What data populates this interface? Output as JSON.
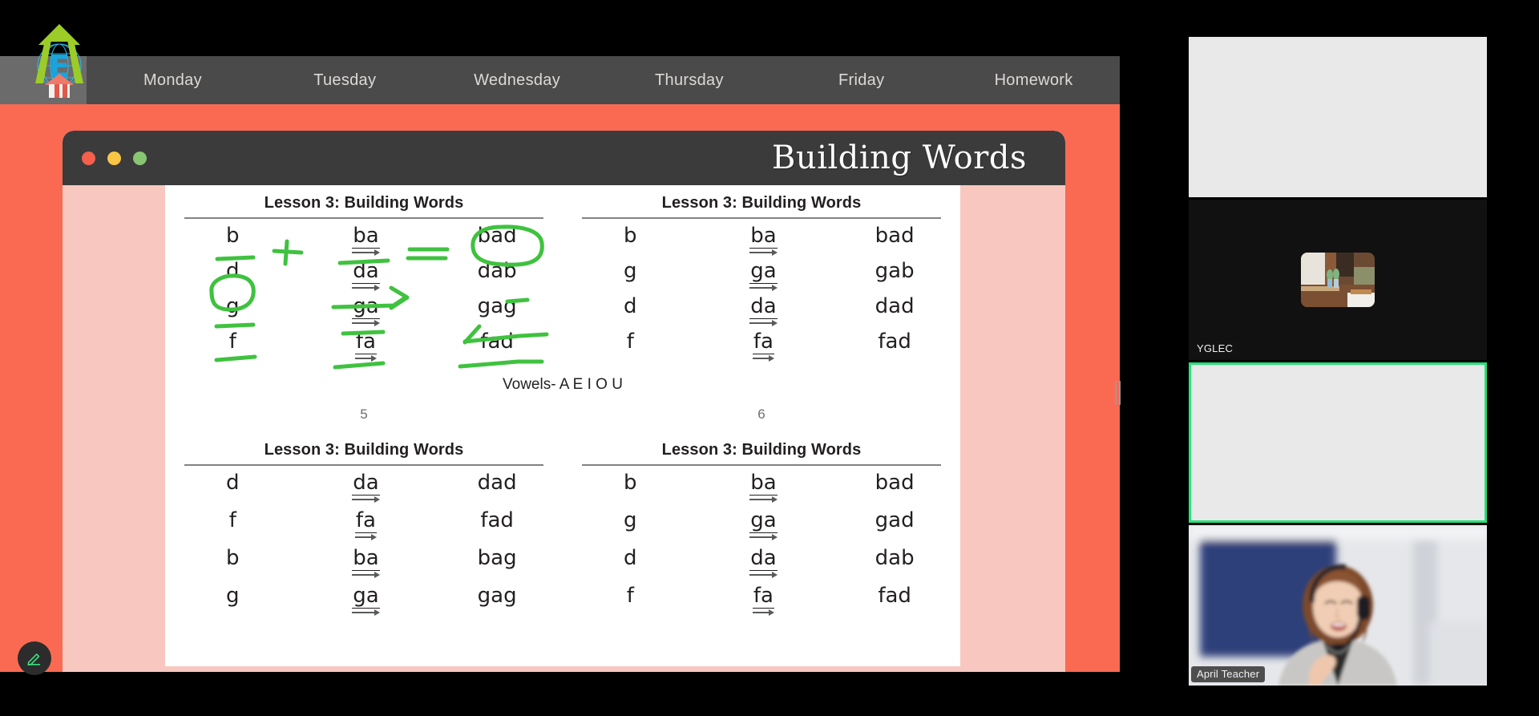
{
  "app": {
    "logo_alt": "school-logo"
  },
  "nav": {
    "tabs": [
      {
        "label": "Monday"
      },
      {
        "label": "Tuesday"
      },
      {
        "label": "Wednesday"
      },
      {
        "label": "Thursday"
      },
      {
        "label": "Friday"
      },
      {
        "label": "Homework"
      }
    ]
  },
  "slide": {
    "title": "Building Words",
    "window_controls": [
      "close",
      "minimize",
      "maximize"
    ]
  },
  "worksheet": {
    "heading": "Lesson 3: Building Words",
    "vowels_note": "Vowels- A E I O U",
    "page_numbers": [
      "5",
      "6"
    ],
    "tables": [
      {
        "id": "top-left",
        "page": "5",
        "rows": [
          {
            "letter": "b",
            "blend": "ba",
            "word": "bad"
          },
          {
            "letter": "d",
            "blend": "da",
            "word": "dab"
          },
          {
            "letter": "g",
            "blend": "ga",
            "word": "gag"
          },
          {
            "letter": "f",
            "blend": "fa",
            "word": "fad"
          }
        ]
      },
      {
        "id": "top-right",
        "page": "6",
        "rows": [
          {
            "letter": "b",
            "blend": "ba",
            "word": "bad"
          },
          {
            "letter": "g",
            "blend": "ga",
            "word": "gab"
          },
          {
            "letter": "d",
            "blend": "da",
            "word": "dad"
          },
          {
            "letter": "f",
            "blend": "fa",
            "word": "fad"
          }
        ]
      },
      {
        "id": "bottom-left",
        "rows": [
          {
            "letter": "d",
            "blend": "da",
            "word": "dad"
          },
          {
            "letter": "f",
            "blend": "fa",
            "word": "fad"
          },
          {
            "letter": "b",
            "blend": "ba",
            "word": "bag"
          },
          {
            "letter": "g",
            "blend": "ga",
            "word": "gag"
          }
        ]
      },
      {
        "id": "bottom-right",
        "rows": [
          {
            "letter": "b",
            "blend": "ba",
            "word": "bad"
          },
          {
            "letter": "g",
            "blend": "ga",
            "word": "gad"
          },
          {
            "letter": "d",
            "blend": "da",
            "word": "dab"
          },
          {
            "letter": "f",
            "blend": "fa",
            "word": "fad"
          }
        ]
      }
    ],
    "annotations": {
      "ink_color": "#3fc23f",
      "marks": [
        "underline under b",
        "plus sign between b and ba",
        "underline under ba",
        "equals sign between ba and bad",
        "circle around bad",
        "circle around d",
        "arrow under da",
        "underline under b in dab",
        "underline under g",
        "arrow pointing to gag",
        "underline above fa",
        "underline under fa",
        "underline under f",
        "underline under fad"
      ]
    }
  },
  "toolbar": {
    "pencil_label": "Annotate",
    "handle_label": "Resize panel"
  },
  "participants": [
    {
      "name": "",
      "state": "blank",
      "active": false
    },
    {
      "name": "YGLEC",
      "state": "avatar",
      "active": false
    },
    {
      "name": "",
      "state": "blank",
      "active": true
    },
    {
      "name": "April Teacher",
      "state": "video",
      "active": false
    }
  ],
  "colors": {
    "accent_orange": "#fa6a53",
    "nav_bar": "#4a4a4a",
    "titlebar": "#3b3b3b",
    "page_margin_pink": "#f8c8c0",
    "ink_green": "#3fc23f",
    "active_border": "#27e07b"
  }
}
